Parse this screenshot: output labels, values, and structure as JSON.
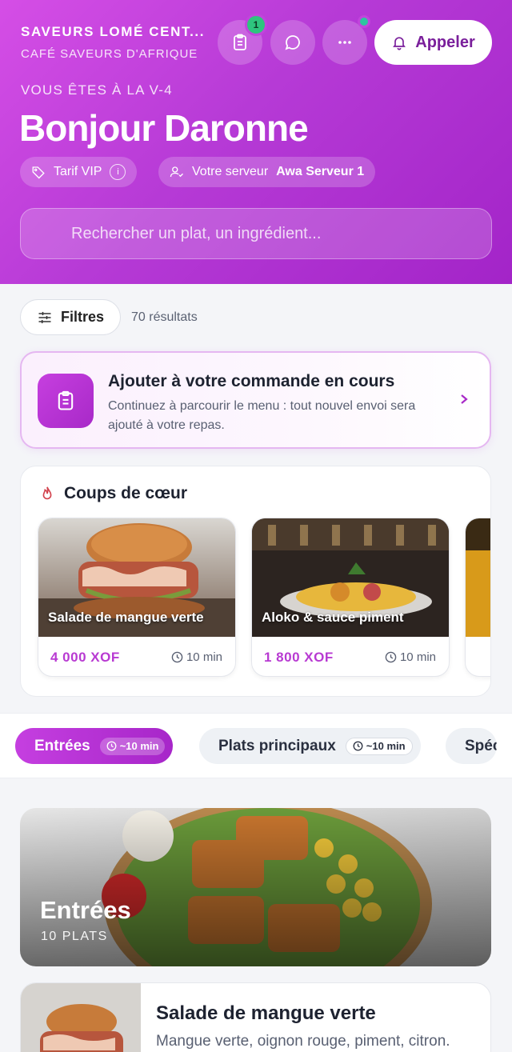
{
  "header": {
    "restaurant_name": "SAVEURS LOMÉ CENT...",
    "restaurant_subtitle": "CAFÉ SAVEURS D'AFRIQUE",
    "orders_badge_count": "1",
    "call_label": "Appeler",
    "location": "VOUS ÊTES À LA V-4",
    "greeting": "Bonjour Daronne",
    "tariff_label": "Tarif VIP",
    "server_prefix": "Votre serveur",
    "server_name": "Awa Serveur 1",
    "search_placeholder": "Rechercher un plat, un ingrédient..."
  },
  "filters": {
    "button_label": "Filtres",
    "results": "70 résultats"
  },
  "order_banner": {
    "title": "Ajouter à votre commande en cours",
    "description": "Continuez à parcourir le menu : tout nouvel envoi sera ajouté à votre repas."
  },
  "favorites": {
    "title": "Coups de cœur",
    "items": [
      {
        "name": "Salade de mangue verte",
        "price": "4 000  XOF",
        "time": "10 min"
      },
      {
        "name": "Aloko & sauce piment",
        "price": "1 800  XOF",
        "time": "10 min"
      }
    ]
  },
  "category_tabs": [
    {
      "label": "Entrées",
      "time": "~10 min",
      "active": true
    },
    {
      "label": "Plats principaux",
      "time": "~10 min",
      "active": false
    },
    {
      "label": "Spéc",
      "time": "",
      "active": false
    }
  ],
  "category_section": {
    "title": "Entrées",
    "count": "10 PLATS"
  },
  "dish_list": [
    {
      "name": "Salade de mangue verte",
      "description": "Mangue verte, oignon rouge, piment, citron."
    }
  ],
  "colors": {
    "brand_primary": "#b63ad6",
    "accent_green": "#2ec47e",
    "price_color": "#b83ad2"
  }
}
